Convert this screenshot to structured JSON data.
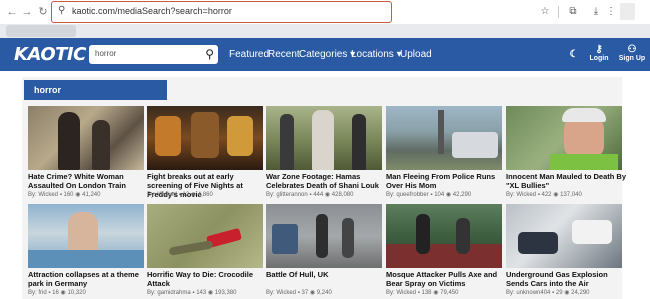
{
  "browser": {
    "url": "kaotic.com/mediaSearch?search=horror"
  },
  "header": {
    "logo_text": "KAOTIC",
    "search_value": "horror",
    "nav": [
      "Featured",
      "Recent",
      "Categories ▾",
      "Locations ▾",
      "Upload"
    ],
    "login_label": "Login",
    "signup_label": "Sign Up"
  },
  "section": {
    "title": "horror"
  },
  "videos": [
    {
      "title": "Hate Crime? White Woman Assaulted On London Train",
      "author": "Wicked",
      "comments": "160",
      "views": "41,240"
    },
    {
      "title": "Fight breaks out at early screening of Five Nights at Freddy's movie",
      "author": "Wicked",
      "comments": "12",
      "views": "4,860"
    },
    {
      "title": "War Zone Footage: Hamas Celebrates Death of Shani Louk",
      "author": "glitterannon",
      "comments": "444",
      "views": "428,080"
    },
    {
      "title": "Man Fleeing From Police Runs Over His Mom",
      "author": "queefrobber",
      "comments": "104",
      "views": "42,290"
    },
    {
      "title": "Innocent Man Mauled to Death By \"XL Bullies\"",
      "author": "Wicked",
      "comments": "422",
      "views": "137,040"
    },
    {
      "title": "Attraction collapses at a theme park in Germany",
      "author": "frid",
      "comments": "16",
      "views": "10,320"
    },
    {
      "title": "Horrific Way to Die: Crocodile Attack",
      "author": "gamidrahma",
      "comments": "143",
      "views": "193,380"
    },
    {
      "title": "Battle Of Hull, UK",
      "author": "Wicked",
      "comments": "37",
      "views": "9,240"
    },
    {
      "title": "Mosque Attacker Pulls Axe and Bear Spray on Victims",
      "author": "Wicked",
      "comments": "138",
      "views": "79,450"
    },
    {
      "title": "Underground Gas Explosion Sends Cars into the Air",
      "author": "unknown404",
      "comments": "29",
      "views": "24,290"
    }
  ],
  "labels": {
    "by": "By:"
  }
}
